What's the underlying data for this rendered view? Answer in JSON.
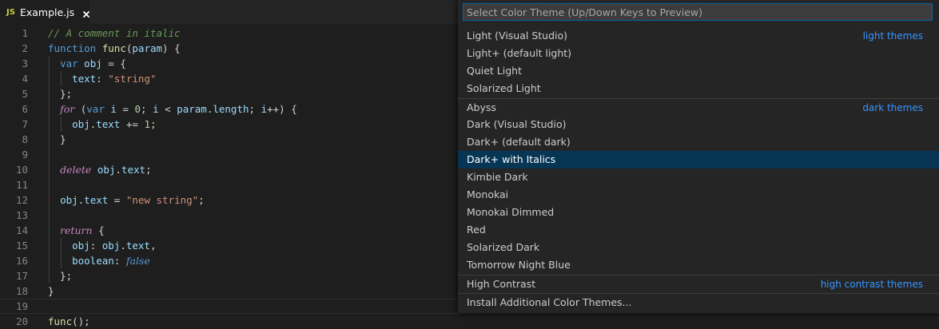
{
  "tab": {
    "icon_text": "JS",
    "filename": "Example.js",
    "close_icon": "close-icon"
  },
  "editor": {
    "lines": [
      {
        "n": "1",
        "tokens": [
          {
            "t": "// A comment in italic",
            "c": "comment"
          }
        ]
      },
      {
        "n": "2",
        "tokens": [
          {
            "t": "function",
            "c": "keyword"
          },
          {
            "t": " ",
            "c": "punc"
          },
          {
            "t": "func",
            "c": "func"
          },
          {
            "t": "(",
            "c": "punc"
          },
          {
            "t": "param",
            "c": "var"
          },
          {
            "t": ") {",
            "c": "punc"
          }
        ]
      },
      {
        "n": "3",
        "tokens": [
          {
            "t": "  ",
            "c": "punc"
          },
          {
            "t": "var",
            "c": "keyword"
          },
          {
            "t": " ",
            "c": "punc"
          },
          {
            "t": "obj",
            "c": "var"
          },
          {
            "t": " = {",
            "c": "punc"
          }
        ]
      },
      {
        "n": "4",
        "tokens": [
          {
            "t": "    ",
            "c": "punc"
          },
          {
            "t": "text",
            "c": "var"
          },
          {
            "t": ": ",
            "c": "punc"
          },
          {
            "t": "\"string\"",
            "c": "str"
          }
        ]
      },
      {
        "n": "5",
        "tokens": [
          {
            "t": "  };",
            "c": "punc"
          }
        ]
      },
      {
        "n": "6",
        "tokens": [
          {
            "t": "  ",
            "c": "punc"
          },
          {
            "t": "for",
            "c": "kwital"
          },
          {
            "t": " (",
            "c": "punc"
          },
          {
            "t": "var",
            "c": "keyword"
          },
          {
            "t": " ",
            "c": "punc"
          },
          {
            "t": "i",
            "c": "var"
          },
          {
            "t": " = ",
            "c": "punc"
          },
          {
            "t": "0",
            "c": "num"
          },
          {
            "t": "; ",
            "c": "punc"
          },
          {
            "t": "i",
            "c": "var"
          },
          {
            "t": " < ",
            "c": "punc"
          },
          {
            "t": "param",
            "c": "var"
          },
          {
            "t": ".",
            "c": "punc"
          },
          {
            "t": "length",
            "c": "var"
          },
          {
            "t": "; ",
            "c": "punc"
          },
          {
            "t": "i",
            "c": "var"
          },
          {
            "t": "++) {",
            "c": "punc"
          }
        ]
      },
      {
        "n": "7",
        "tokens": [
          {
            "t": "    ",
            "c": "punc"
          },
          {
            "t": "obj",
            "c": "var"
          },
          {
            "t": ".",
            "c": "punc"
          },
          {
            "t": "text",
            "c": "var"
          },
          {
            "t": " += ",
            "c": "punc"
          },
          {
            "t": "1",
            "c": "num"
          },
          {
            "t": ";",
            "c": "punc"
          }
        ]
      },
      {
        "n": "8",
        "tokens": [
          {
            "t": "  }",
            "c": "punc"
          }
        ]
      },
      {
        "n": "9",
        "tokens": []
      },
      {
        "n": "10",
        "tokens": [
          {
            "t": "  ",
            "c": "punc"
          },
          {
            "t": "delete",
            "c": "kwital"
          },
          {
            "t": " ",
            "c": "punc"
          },
          {
            "t": "obj",
            "c": "var"
          },
          {
            "t": ".",
            "c": "punc"
          },
          {
            "t": "text",
            "c": "var"
          },
          {
            "t": ";",
            "c": "punc"
          }
        ]
      },
      {
        "n": "11",
        "tokens": []
      },
      {
        "n": "12",
        "tokens": [
          {
            "t": "  ",
            "c": "punc"
          },
          {
            "t": "obj",
            "c": "var"
          },
          {
            "t": ".",
            "c": "punc"
          },
          {
            "t": "text",
            "c": "var"
          },
          {
            "t": " = ",
            "c": "punc"
          },
          {
            "t": "\"new string\"",
            "c": "str"
          },
          {
            "t": ";",
            "c": "punc"
          }
        ]
      },
      {
        "n": "13",
        "tokens": []
      },
      {
        "n": "14",
        "tokens": [
          {
            "t": "  ",
            "c": "punc"
          },
          {
            "t": "return",
            "c": "kwital"
          },
          {
            "t": " {",
            "c": "punc"
          }
        ]
      },
      {
        "n": "15",
        "tokens": [
          {
            "t": "    ",
            "c": "punc"
          },
          {
            "t": "obj",
            "c": "var"
          },
          {
            "t": ": ",
            "c": "punc"
          },
          {
            "t": "obj",
            "c": "var"
          },
          {
            "t": ".",
            "c": "punc"
          },
          {
            "t": "text",
            "c": "var"
          },
          {
            "t": ",",
            "c": "punc"
          }
        ]
      },
      {
        "n": "16",
        "tokens": [
          {
            "t": "    ",
            "c": "punc"
          },
          {
            "t": "boolean",
            "c": "var"
          },
          {
            "t": ": ",
            "c": "punc"
          },
          {
            "t": "false",
            "c": "const"
          }
        ]
      },
      {
        "n": "17",
        "tokens": [
          {
            "t": "  };",
            "c": "punc"
          }
        ]
      },
      {
        "n": "18",
        "tokens": [
          {
            "t": "}",
            "c": "punc"
          }
        ]
      },
      {
        "n": "19",
        "tokens": [],
        "current": true
      },
      {
        "n": "20",
        "tokens": [
          {
            "t": "func",
            "c": "func"
          },
          {
            "t": "();",
            "c": "punc"
          }
        ]
      }
    ]
  },
  "quickpick": {
    "placeholder": "Select Color Theme (Up/Down Keys to Preview)",
    "items": [
      {
        "label": "Light (Visual Studio)",
        "group": "light themes"
      },
      {
        "label": "Light+ (default light)"
      },
      {
        "label": "Quiet Light"
      },
      {
        "label": "Solarized Light"
      },
      {
        "label": "Abyss",
        "group": "dark themes",
        "separator": true
      },
      {
        "label": "Dark (Visual Studio)"
      },
      {
        "label": "Dark+ (default dark)"
      },
      {
        "label": "Dark+ with Italics",
        "selected": true
      },
      {
        "label": "Kimbie Dark"
      },
      {
        "label": "Monokai"
      },
      {
        "label": "Monokai Dimmed"
      },
      {
        "label": "Red"
      },
      {
        "label": "Solarized Dark"
      },
      {
        "label": "Tomorrow Night Blue"
      },
      {
        "label": "High Contrast",
        "group": "high contrast themes",
        "separator": true
      },
      {
        "label": "Install Additional Color Themes...",
        "separator": true
      }
    ]
  },
  "colors": {
    "editor_background": "#1e1e1e",
    "selection": "#073655",
    "group_label": "#3794ff",
    "input_border": "#0e639c"
  }
}
